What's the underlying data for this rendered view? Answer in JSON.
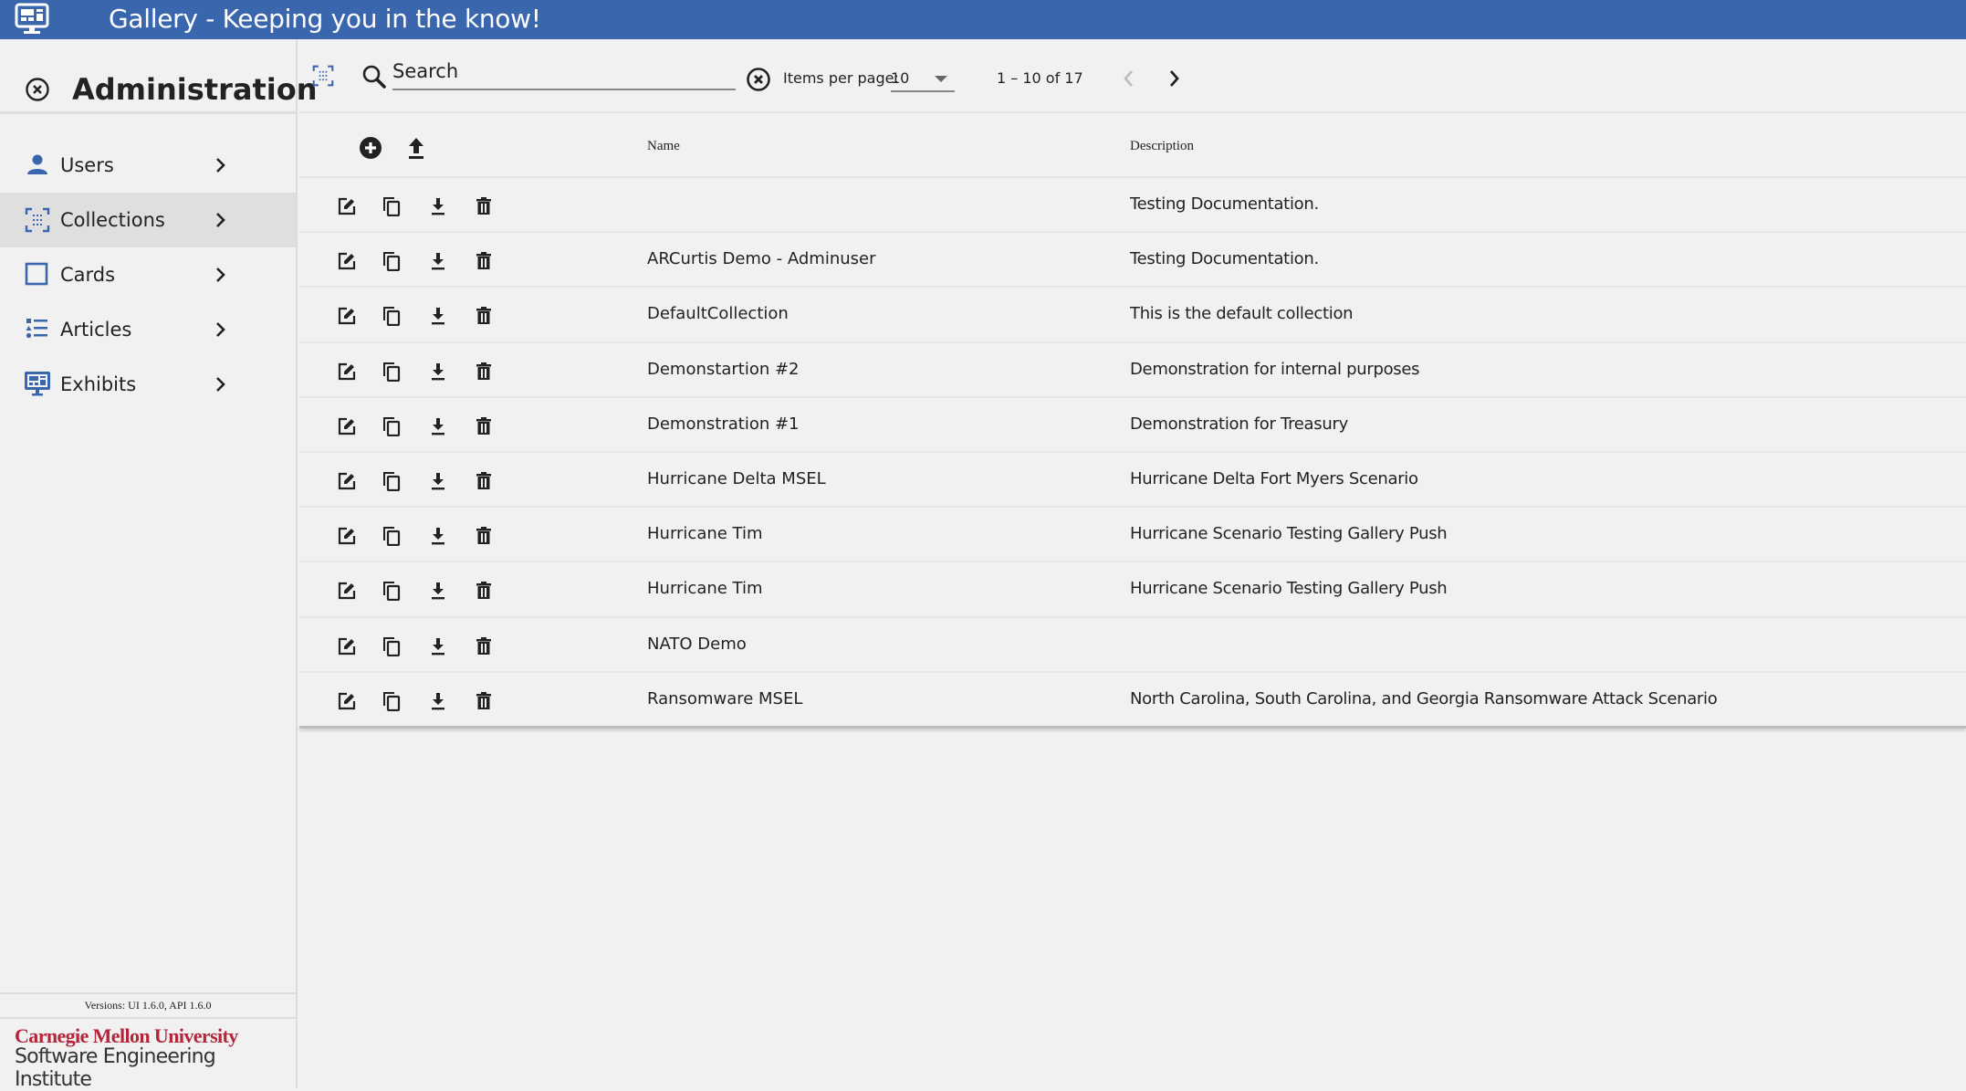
{
  "app": {
    "title": "Gallery - Keeping you in the know!",
    "brand_color": "#3a66ae"
  },
  "sidebar": {
    "heading": "Administration",
    "items": [
      {
        "label": "Users",
        "icon": "person-icon",
        "selected": false
      },
      {
        "label": "Collections",
        "icon": "collections-icon",
        "selected": true
      },
      {
        "label": "Cards",
        "icon": "card-square-icon",
        "selected": false
      },
      {
        "label": "Articles",
        "icon": "list-icon",
        "selected": false
      },
      {
        "label": "Exhibits",
        "icon": "monitor-icon",
        "selected": false
      }
    ],
    "versions": "Versions: UI 1.6.0, API 1.6.0",
    "footer": {
      "org": "Carnegie Mellon University",
      "institute": "Software Engineering Institute"
    }
  },
  "toolbar": {
    "search_placeholder": "Search",
    "search_value": "",
    "items_per_page_label": "Items per page:",
    "items_per_page": "10",
    "range_label": "1 – 10 of 17"
  },
  "table": {
    "columns": [
      "Name",
      "Description"
    ],
    "rows": [
      {
        "name": "",
        "description": "Testing Documentation."
      },
      {
        "name": "ARCurtis Demo - Adminuser",
        "description": "Testing Documentation."
      },
      {
        "name": "DefaultCollection",
        "description": "This is the default collection"
      },
      {
        "name": "Demonstartion #2",
        "description": "Demonstration for internal purposes"
      },
      {
        "name": "Demonstration #1",
        "description": "Demonstration for Treasury"
      },
      {
        "name": "Hurricane Delta MSEL",
        "description": "Hurricane Delta Fort Myers Scenario"
      },
      {
        "name": "Hurricane Tim",
        "description": "Hurricane Scenario Testing Gallery Push"
      },
      {
        "name": "Hurricane Tim",
        "description": "Hurricane Scenario Testing Gallery Push"
      },
      {
        "name": "NATO Demo",
        "description": ""
      },
      {
        "name": "Ransomware MSEL",
        "description": "North Carolina, South Carolina, and Georgia Ransomware Attack Scenario"
      }
    ]
  }
}
